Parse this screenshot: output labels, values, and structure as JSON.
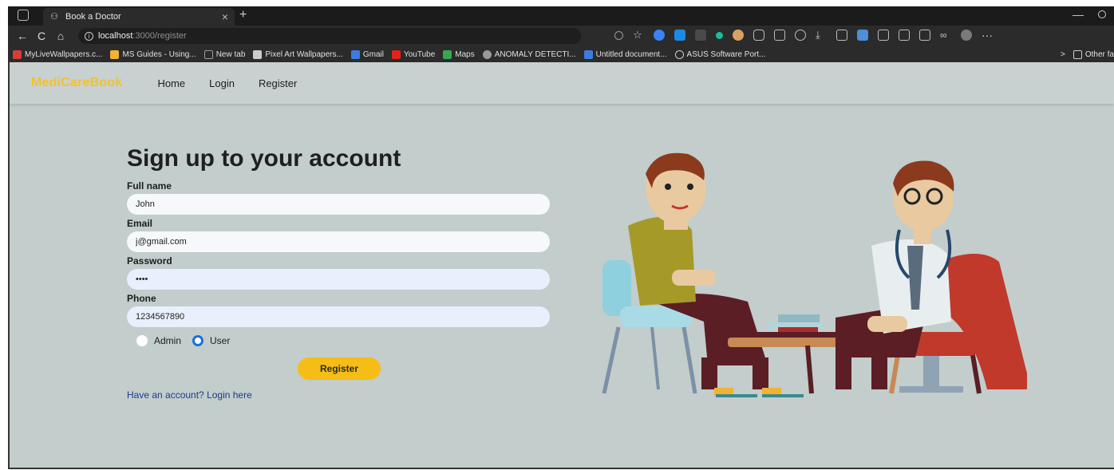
{
  "browser": {
    "tab_title": "Book a Doctor",
    "new_tab_symbol": "+",
    "close_symbol": "×",
    "url_host": "localhost",
    "url_rest": ":3000/register",
    "minimize_symbol": "—",
    "back_symbol": "←",
    "reload_symbol": "C",
    "home_symbol": "⌂",
    "more_symbol": "···",
    "bookmarks": [
      {
        "label": "MyLiveWallpapers.c...",
        "color": "#d93b3b"
      },
      {
        "label": "MS Guides - Using...",
        "color": "#f2b233"
      },
      {
        "label": "New tab",
        "color": "#9a9a9a"
      },
      {
        "label": "Pixel Art Wallpapers...",
        "color": "#cccccc"
      },
      {
        "label": "Gmail",
        "color": "#3c7be0"
      },
      {
        "label": "YouTube",
        "color": "#e62117"
      },
      {
        "label": "Maps",
        "color": "#34a853"
      },
      {
        "label": "ANOMALY DETECTI...",
        "color": "#9a9a9a"
      },
      {
        "label": "Untitled document...",
        "color": "#3c7be0"
      },
      {
        "label": "ASUS Software Port...",
        "color": "#cccccc"
      }
    ],
    "bookmarks_overflow": ">",
    "other_favorites": "Other fa"
  },
  "site": {
    "brand": "MediCareBook",
    "nav": [
      "Home",
      "Login",
      "Register"
    ]
  },
  "form": {
    "title": "Sign up to your account",
    "fields": [
      {
        "label": "Full name",
        "value": "John",
        "type": "text"
      },
      {
        "label": "Email",
        "value": "j@gmail.com",
        "type": "text"
      },
      {
        "label": "Password",
        "value": "••••",
        "type": "password"
      },
      {
        "label": "Phone",
        "value": "1234567890",
        "type": "text"
      }
    ],
    "roles": [
      {
        "label": "Admin",
        "checked": false
      },
      {
        "label": "User",
        "checked": true
      }
    ],
    "submit_label": "Register",
    "login_link": "Have an account? Login here"
  },
  "colors": {
    "brand": "#f2c22a",
    "button": "#f6bd16",
    "page_bg": "#c2cdcc",
    "radio_selected": "#1a6fe0"
  }
}
